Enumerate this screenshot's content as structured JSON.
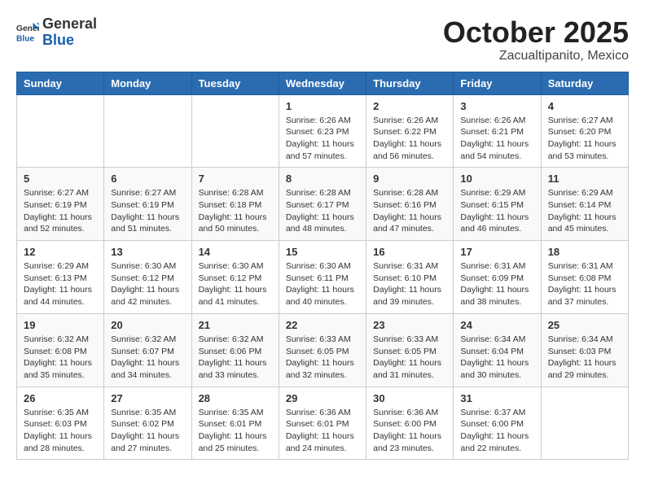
{
  "logo": {
    "general": "General",
    "blue": "Blue"
  },
  "title": "October 2025",
  "location": "Zacualtipanito, Mexico",
  "days_of_week": [
    "Sunday",
    "Monday",
    "Tuesday",
    "Wednesday",
    "Thursday",
    "Friday",
    "Saturday"
  ],
  "weeks": [
    [
      null,
      null,
      null,
      {
        "day": 1,
        "sunrise": "6:26 AM",
        "sunset": "6:23 PM",
        "daylight": "11 hours and 57 minutes."
      },
      {
        "day": 2,
        "sunrise": "6:26 AM",
        "sunset": "6:22 PM",
        "daylight": "11 hours and 56 minutes."
      },
      {
        "day": 3,
        "sunrise": "6:26 AM",
        "sunset": "6:21 PM",
        "daylight": "11 hours and 54 minutes."
      },
      {
        "day": 4,
        "sunrise": "6:27 AM",
        "sunset": "6:20 PM",
        "daylight": "11 hours and 53 minutes."
      }
    ],
    [
      {
        "day": 5,
        "sunrise": "6:27 AM",
        "sunset": "6:19 PM",
        "daylight": "11 hours and 52 minutes."
      },
      {
        "day": 6,
        "sunrise": "6:27 AM",
        "sunset": "6:19 PM",
        "daylight": "11 hours and 51 minutes."
      },
      {
        "day": 7,
        "sunrise": "6:28 AM",
        "sunset": "6:18 PM",
        "daylight": "11 hours and 50 minutes."
      },
      {
        "day": 8,
        "sunrise": "6:28 AM",
        "sunset": "6:17 PM",
        "daylight": "11 hours and 48 minutes."
      },
      {
        "day": 9,
        "sunrise": "6:28 AM",
        "sunset": "6:16 PM",
        "daylight": "11 hours and 47 minutes."
      },
      {
        "day": 10,
        "sunrise": "6:29 AM",
        "sunset": "6:15 PM",
        "daylight": "11 hours and 46 minutes."
      },
      {
        "day": 11,
        "sunrise": "6:29 AM",
        "sunset": "6:14 PM",
        "daylight": "11 hours and 45 minutes."
      }
    ],
    [
      {
        "day": 12,
        "sunrise": "6:29 AM",
        "sunset": "6:13 PM",
        "daylight": "11 hours and 44 minutes."
      },
      {
        "day": 13,
        "sunrise": "6:30 AM",
        "sunset": "6:12 PM",
        "daylight": "11 hours and 42 minutes."
      },
      {
        "day": 14,
        "sunrise": "6:30 AM",
        "sunset": "6:12 PM",
        "daylight": "11 hours and 41 minutes."
      },
      {
        "day": 15,
        "sunrise": "6:30 AM",
        "sunset": "6:11 PM",
        "daylight": "11 hours and 40 minutes."
      },
      {
        "day": 16,
        "sunrise": "6:31 AM",
        "sunset": "6:10 PM",
        "daylight": "11 hours and 39 minutes."
      },
      {
        "day": 17,
        "sunrise": "6:31 AM",
        "sunset": "6:09 PM",
        "daylight": "11 hours and 38 minutes."
      },
      {
        "day": 18,
        "sunrise": "6:31 AM",
        "sunset": "6:08 PM",
        "daylight": "11 hours and 37 minutes."
      }
    ],
    [
      {
        "day": 19,
        "sunrise": "6:32 AM",
        "sunset": "6:08 PM",
        "daylight": "11 hours and 35 minutes."
      },
      {
        "day": 20,
        "sunrise": "6:32 AM",
        "sunset": "6:07 PM",
        "daylight": "11 hours and 34 minutes."
      },
      {
        "day": 21,
        "sunrise": "6:32 AM",
        "sunset": "6:06 PM",
        "daylight": "11 hours and 33 minutes."
      },
      {
        "day": 22,
        "sunrise": "6:33 AM",
        "sunset": "6:05 PM",
        "daylight": "11 hours and 32 minutes."
      },
      {
        "day": 23,
        "sunrise": "6:33 AM",
        "sunset": "6:05 PM",
        "daylight": "11 hours and 31 minutes."
      },
      {
        "day": 24,
        "sunrise": "6:34 AM",
        "sunset": "6:04 PM",
        "daylight": "11 hours and 30 minutes."
      },
      {
        "day": 25,
        "sunrise": "6:34 AM",
        "sunset": "6:03 PM",
        "daylight": "11 hours and 29 minutes."
      }
    ],
    [
      {
        "day": 26,
        "sunrise": "6:35 AM",
        "sunset": "6:03 PM",
        "daylight": "11 hours and 28 minutes."
      },
      {
        "day": 27,
        "sunrise": "6:35 AM",
        "sunset": "6:02 PM",
        "daylight": "11 hours and 27 minutes."
      },
      {
        "day": 28,
        "sunrise": "6:35 AM",
        "sunset": "6:01 PM",
        "daylight": "11 hours and 25 minutes."
      },
      {
        "day": 29,
        "sunrise": "6:36 AM",
        "sunset": "6:01 PM",
        "daylight": "11 hours and 24 minutes."
      },
      {
        "day": 30,
        "sunrise": "6:36 AM",
        "sunset": "6:00 PM",
        "daylight": "11 hours and 23 minutes."
      },
      {
        "day": 31,
        "sunrise": "6:37 AM",
        "sunset": "6:00 PM",
        "daylight": "11 hours and 22 minutes."
      },
      null
    ]
  ]
}
